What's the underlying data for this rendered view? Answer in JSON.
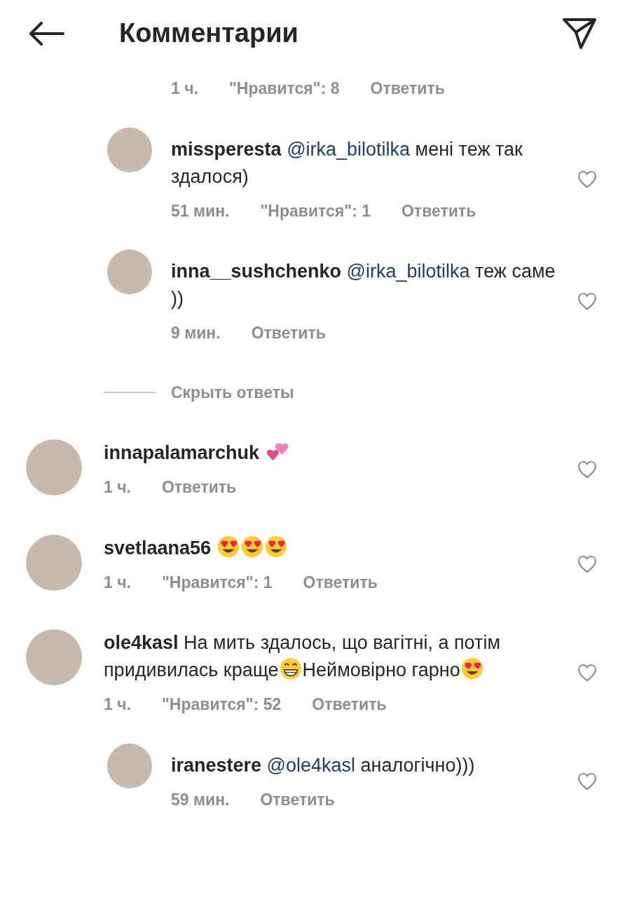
{
  "header": {
    "title": "Комментарии"
  },
  "top_meta": {
    "time": "1 ч.",
    "likes": "\"Нравится\": 8",
    "reply": "Ответить"
  },
  "comments": [
    {
      "kind": "reply",
      "username": "missperesta",
      "body": [
        {
          "kind": "mention",
          "text": "@irka_bilotilka"
        },
        {
          "kind": "text",
          "text": "мені теж так здалося)"
        }
      ],
      "time": "51 мин.",
      "likes": "\"Нравится\": 1",
      "reply": "Ответить"
    },
    {
      "kind": "reply",
      "username": "inna__sushchenko",
      "body": [
        {
          "kind": "mention",
          "text": "@irka_bilotilka"
        },
        {
          "kind": "text",
          "text": "теж саме ))"
        }
      ],
      "time": "9 мин.",
      "reply": "Ответить",
      "hide_replies": "Скрыть ответы"
    },
    {
      "kind": "comment",
      "username": "innapalamarchuk",
      "body": [
        {
          "kind": "two-hearts-emoji"
        }
      ],
      "time": "1 ч.",
      "reply": "Ответить"
    },
    {
      "kind": "comment",
      "username": "svetlaana56",
      "body": [
        {
          "kind": "heart-eyes-emoji"
        },
        {
          "kind": "heart-eyes-emoji"
        },
        {
          "kind": "heart-eyes-emoji"
        }
      ],
      "time": "1 ч.",
      "likes": "\"Нравится\": 1",
      "reply": "Ответить"
    },
    {
      "kind": "comment",
      "username": "ole4kasl",
      "body": [
        {
          "kind": "text",
          "text": "На мить здалось, що вагітні, а потім придивилась краще"
        },
        {
          "kind": "grin-emoji"
        },
        {
          "kind": "text",
          "text": "Неймовірно гарно"
        },
        {
          "kind": "heart-eyes-emoji"
        }
      ],
      "time": "1 ч.",
      "likes": "\"Нравится\": 52",
      "reply": "Ответить"
    },
    {
      "kind": "reply",
      "username": "iranestere",
      "body": [
        {
          "kind": "mention",
          "text": "@ole4kasl"
        },
        {
          "kind": "text",
          "text": "аналогічно)))"
        }
      ],
      "time": "59 мин.",
      "reply": "Ответить"
    }
  ]
}
